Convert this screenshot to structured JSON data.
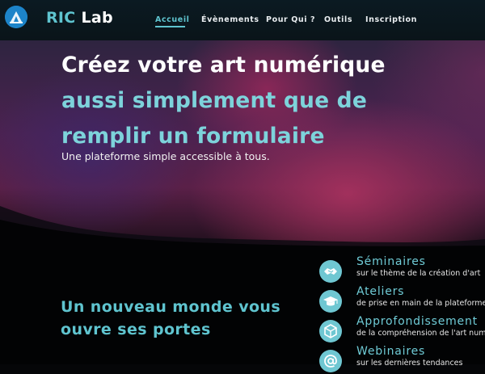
{
  "header": {
    "brand_ric": "RIC",
    "brand_lab": " Lab",
    "logo_icon": "ric-lab-logo",
    "nav": [
      {
        "label": "Accueil",
        "active": true
      },
      {
        "label": "Évènements",
        "active": false
      },
      {
        "label": "Pour Qui ?",
        "active": false
      },
      {
        "label": "Outils",
        "active": false
      },
      {
        "label": "Inscription",
        "active": false
      }
    ]
  },
  "hero": {
    "title_line1": "Créez votre art numérique",
    "title_line2": "aussi simplement que de",
    "title_line3": "remplir un formulaire",
    "subtitle": "Une plateforme simple accessible à tous."
  },
  "section": {
    "title_line1": "Un nouveau monde vous",
    "title_line2": "ouvre ses portes"
  },
  "features": [
    {
      "title": "Séminaires",
      "desc": "sur le thème de la création d'art",
      "icon": "handshake-icon"
    },
    {
      "title": "Ateliers",
      "desc": "de prise en main de la plateforme",
      "icon": "graduation-cap-icon"
    },
    {
      "title": "Approfondissement",
      "desc": "de la compréhension de l'art num",
      "icon": "cube-icon"
    },
    {
      "title": "Webinaires",
      "desc": "sur les dernières tendances",
      "icon": "at-sign-icon"
    }
  ],
  "colors": {
    "accent": "#5fc4cf",
    "header_bg": "#0b1a22",
    "icon_circle": "#6fc7d2",
    "lower_bg": "#020304"
  }
}
